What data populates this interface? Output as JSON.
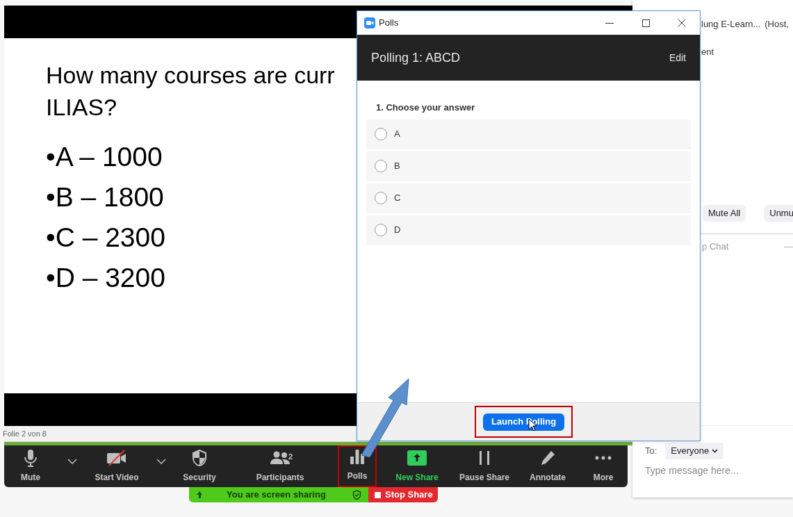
{
  "slide": {
    "title_lines": [
      "How many courses are curr",
      "ILIAS?"
    ],
    "bullets": [
      "•A – 1000",
      "•B – 1800",
      "•C – 2300",
      "•D – 3200"
    ],
    "status": "Folie 2 von 8"
  },
  "toolbar": [
    {
      "kind": "mic",
      "label": "Mute",
      "has_menu": true,
      "highlighted": false
    },
    {
      "kind": "video_off",
      "label": "Start Video",
      "has_menu": true,
      "highlighted": false
    },
    {
      "kind": "shield",
      "label": "Security",
      "has_menu": false,
      "highlighted": false
    },
    {
      "kind": "people",
      "label": "Participants",
      "has_menu": false,
      "highlighted": false,
      "badge": "2"
    },
    {
      "kind": "bars",
      "label": "Polls",
      "has_menu": false,
      "highlighted": true
    },
    {
      "kind": "share",
      "label": "New Share",
      "has_menu": false,
      "highlighted": false
    },
    {
      "kind": "pause",
      "label": "Pause Share",
      "has_menu": false,
      "highlighted": false
    },
    {
      "kind": "pencil",
      "label": "Annotate",
      "has_menu": false,
      "highlighted": false
    },
    {
      "kind": "dots",
      "label": "More",
      "has_menu": false,
      "highlighted": false
    }
  ],
  "sharing_bar": {
    "message": "You are screen sharing",
    "stop_button": "Stop Share"
  },
  "polls_window": {
    "title": "Polls",
    "poll_title": "Polling 1: ABCD",
    "edit": "Edit",
    "question": "1. Choose your answer",
    "options": [
      {
        "label": "A",
        "selected": false
      },
      {
        "label": "B",
        "selected": false
      },
      {
        "label": "C",
        "selected": false
      },
      {
        "label": "D",
        "selected": false
      }
    ],
    "launch_button": "Launch Polling",
    "launch_highlighted": true
  },
  "side_panel": {
    "meeting_name": "lung E-Learn...",
    "host_tag": "(Host,",
    "line_2": "ent",
    "buttons": [
      "Mute All",
      "Unmu"
    ],
    "chat_title": "p Chat",
    "chat_minimize": "—",
    "to_label": "To:",
    "recipient": "Everyone",
    "message_placeholder": "Type message here..."
  }
}
